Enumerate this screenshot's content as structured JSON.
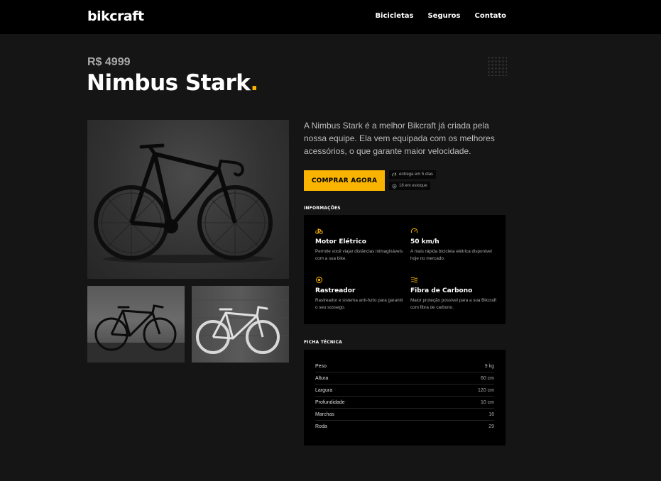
{
  "header": {
    "logo": "bikcraft",
    "nav": [
      "Bicicletas",
      "Seguros",
      "Contato"
    ]
  },
  "product": {
    "price": "R$ 4999",
    "name": "Nimbus Stark",
    "name_dot": ".",
    "description": "A Nimbus Stark é a melhor Bikcraft já criada pela nossa equipe. Ela vem equipada com os melhores acessórios, o que garante maior velocidade."
  },
  "actions": {
    "buy_label": "COMPRAR AGORA",
    "delivery": "entrega em 5 dias",
    "stock": "18 em estoque"
  },
  "info": {
    "label": "INFORMAÇÕES",
    "features": [
      {
        "icon": "bike-icon",
        "name": "Motor Elétrico",
        "text": "Permite você viajar distâncias inimagináveis com a sua bike."
      },
      {
        "icon": "speedometer-icon",
        "name": "50 km/h",
        "text": "A mais rápida bicicleta elétrica disponível hoje no mercado."
      },
      {
        "icon": "tracker-icon",
        "name": "Rastreador",
        "text": "Rastreador e sistema anti-furto para garantir o seu sossego."
      },
      {
        "icon": "carbon-fiber-icon",
        "name": "Fibra de Carbono",
        "text": "Maior proteção possível para a sua Bikcraft com fibra de carbono."
      }
    ]
  },
  "specs": {
    "label": "FICHA TÉCNICA",
    "rows": [
      {
        "name": "Peso",
        "value": "9 kg"
      },
      {
        "name": "Altura",
        "value": "60 cm"
      },
      {
        "name": "Largura",
        "value": "120 cm"
      },
      {
        "name": "Profundidade",
        "value": "10 cm"
      },
      {
        "name": "Marchas",
        "value": "16"
      },
      {
        "name": "Roda",
        "value": "29"
      }
    ]
  },
  "colors": {
    "accent": "#f8b400",
    "background": "#151515",
    "header": "#000000"
  }
}
